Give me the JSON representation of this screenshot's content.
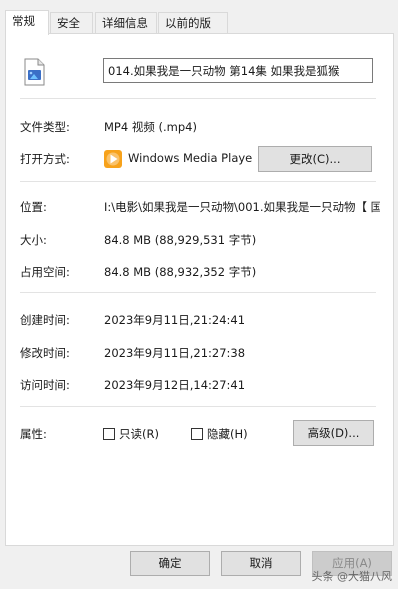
{
  "tabs": [
    "常规",
    "安全",
    "详细信息",
    "以前的版本"
  ],
  "file_name": "014.如果我是一只动物 第14集 如果我是狐猴",
  "file_type_label": "文件类型:",
  "file_type_value": "MP4 视频 (.mp4)",
  "opens_with_label": "打开方式:",
  "opens_with_value": "Windows Media Playe",
  "change_button": "更改(C)...",
  "location_label": "位置:",
  "location_value": "I:\\电影\\如果我是一只动物\\001.如果我是一只动物【 国",
  "size_label": "大小:",
  "size_value": "84.8 MB (88,929,531 字节)",
  "size_on_disk_label": "占用空间:",
  "size_on_disk_value": "84.8 MB (88,932,352 字节)",
  "created_label": "创建时间:",
  "created_value": "2023年9月11日,21:24:41",
  "modified_label": "修改时间:",
  "modified_value": "2023年9月11日,21:27:38",
  "accessed_label": "访问时间:",
  "accessed_value": "2023年9月12日,14:27:41",
  "attributes_label": "属性:",
  "readonly_label": "只读(R)",
  "hidden_label": "隐藏(H)",
  "advanced_button": "高级(D)...",
  "ok_button": "确定",
  "cancel_button": "取消",
  "apply_button": "应用(A)",
  "watermark": "头条 @大猫八风"
}
